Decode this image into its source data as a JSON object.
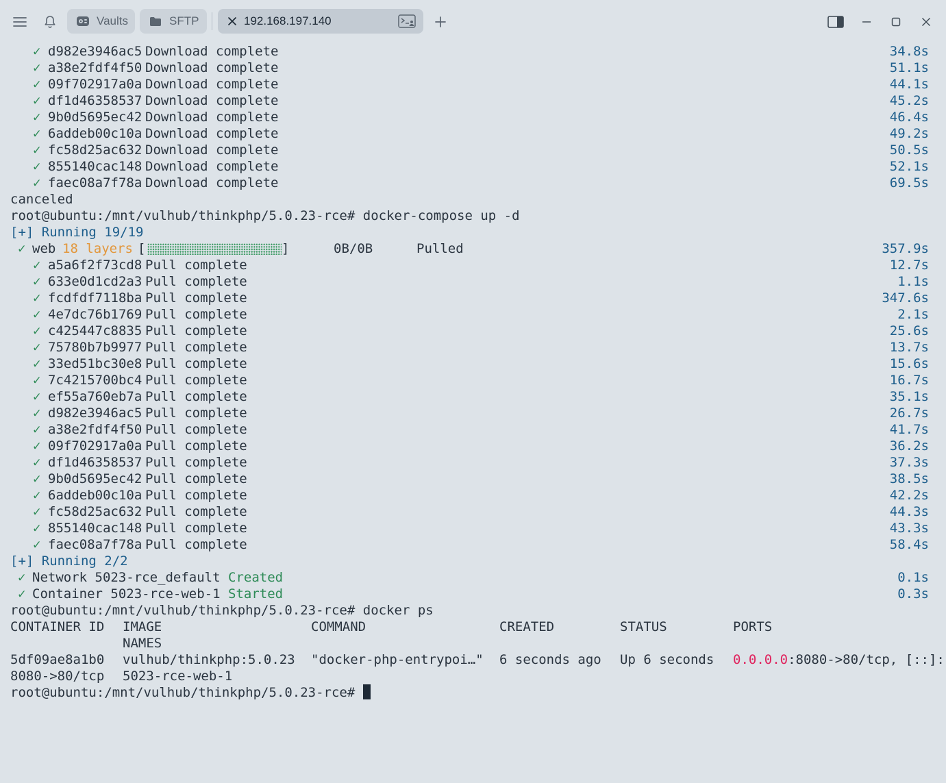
{
  "window": {
    "tabs": [
      {
        "label": "Vaults",
        "icon": "vault-icon"
      },
      {
        "label": "SFTP",
        "icon": "folder-icon"
      },
      {
        "label": "192.168.197.140",
        "icon": "terminal-icon"
      }
    ],
    "controls": [
      "sidebar-toggle-icon",
      "minimize-icon",
      "maximize-icon",
      "close-icon"
    ]
  },
  "terminal": {
    "check_mark": "✓",
    "download_layers": [
      {
        "id": "d982e3946ac5",
        "status": "Download complete",
        "time": "34.8s"
      },
      {
        "id": "a38e2fdf4f50",
        "status": "Download complete",
        "time": "51.1s"
      },
      {
        "id": "09f702917a0a",
        "status": "Download complete",
        "time": "44.1s"
      },
      {
        "id": "df1d46358537",
        "status": "Download complete",
        "time": "45.2s"
      },
      {
        "id": "9b0d5695ec42",
        "status": "Download complete",
        "time": "46.4s"
      },
      {
        "id": "6addeb00c10a",
        "status": "Download complete",
        "time": "49.2s"
      },
      {
        "id": "fc58d25ac632",
        "status": "Download complete",
        "time": "50.5s"
      },
      {
        "id": "855140cac148",
        "status": "Download complete",
        "time": "52.1s"
      },
      {
        "id": "faec08a7f78a",
        "status": "Download complete",
        "time": "69.5s"
      }
    ],
    "canceled": "canceled",
    "prompt": "root@ubuntu:/mnt/vulhub/thinkphp/5.0.23-rce# ",
    "cmd_compose": "docker-compose up -d",
    "running1": "[+] Running 19/19",
    "web": {
      "name": "web",
      "layers": "18 layers",
      "bracket_open": "[",
      "bracket_close": "]",
      "size": "0B/0B",
      "status": "Pulled",
      "time": "357.9s",
      "progress": 1.0
    },
    "pull_layers": [
      {
        "id": "a5a6f2f73cd8",
        "status": "Pull complete",
        "time": "12.7s"
      },
      {
        "id": "633e0d1cd2a3",
        "status": "Pull complete",
        "time": "1.1s"
      },
      {
        "id": "fcdfdf7118ba",
        "status": "Pull complete",
        "time": "347.6s"
      },
      {
        "id": "4e7dc76b1769",
        "status": "Pull complete",
        "time": "2.1s"
      },
      {
        "id": "c425447c8835",
        "status": "Pull complete",
        "time": "25.6s"
      },
      {
        "id": "75780b7b9977",
        "status": "Pull complete",
        "time": "13.7s"
      },
      {
        "id": "33ed51bc30e8",
        "status": "Pull complete",
        "time": "15.6s"
      },
      {
        "id": "7c4215700bc4",
        "status": "Pull complete",
        "time": "16.7s"
      },
      {
        "id": "ef55a760eb7a",
        "status": "Pull complete",
        "time": "35.1s"
      },
      {
        "id": "d982e3946ac5",
        "status": "Pull complete",
        "time": "26.7s"
      },
      {
        "id": "a38e2fdf4f50",
        "status": "Pull complete",
        "time": "41.7s"
      },
      {
        "id": "09f702917a0a",
        "status": "Pull complete",
        "time": "36.2s"
      },
      {
        "id": "df1d46358537",
        "status": "Pull complete",
        "time": "37.3s"
      },
      {
        "id": "9b0d5695ec42",
        "status": "Pull complete",
        "time": "38.5s"
      },
      {
        "id": "6addeb00c10a",
        "status": "Pull complete",
        "time": "42.2s"
      },
      {
        "id": "fc58d25ac632",
        "status": "Pull complete",
        "time": "44.3s"
      },
      {
        "id": "855140cac148",
        "status": "Pull complete",
        "time": "43.3s"
      },
      {
        "id": "faec08a7f78a",
        "status": "Pull complete",
        "time": "58.4s"
      }
    ],
    "running2": "[+] Running 2/2",
    "network": {
      "label": "Network 5023-rce_default",
      "status": "Created",
      "time": "0.1s"
    },
    "container": {
      "label": "Container 5023-rce-web-1",
      "status": "Started",
      "time": "0.3s"
    },
    "cmd_ps": "docker ps",
    "ps_headers": {
      "container_id": "CONTAINER ID",
      "image": "IMAGE",
      "command": "COMMAND",
      "created": "CREATED",
      "status": "STATUS",
      "ports": "PORTS",
      "names": "NAMES"
    },
    "ps_row": {
      "container_id": "5df09ae8a1b0",
      "image": "vulhub/thinkphp:5.0.23",
      "command": "\"docker-php-entrypoi…\"",
      "created": "6 seconds ago",
      "status": "Up 6 seconds",
      "ports_ip": "0.0.0.0",
      "ports_rest": ":8080->80/tcp, [::]:",
      "ports_wrap": "8080->80/tcp",
      "names": "5023-rce-web-1"
    }
  }
}
